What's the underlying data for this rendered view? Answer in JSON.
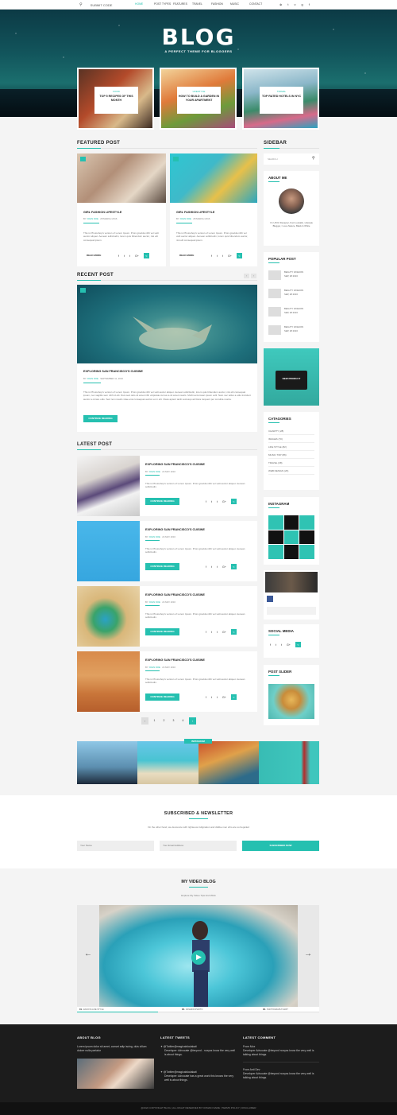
{
  "topbar": {
    "search_placeholder": "SUBMIT CODE",
    "nav": [
      "HOME",
      "POST TYPES",
      "FEATURES",
      "TRAVEL",
      "FASHION",
      "MUSIC",
      "CONTACT"
    ],
    "social_icons": [
      "rss-icon",
      "twitter-icon",
      "vimeo-icon",
      "google-plus-icon",
      "facebook-icon"
    ]
  },
  "hero": {
    "logo": "BLOG",
    "tagline": "A PERFECT THEME FOR BLOGGERS",
    "cards": [
      {
        "category": "FOOD",
        "title": "TOP 5 RECIPES OF THIS MONTH"
      },
      {
        "category": "LIFESTYLE",
        "title": "HOW TO BUILD A GARDEN IN YOUR APARTMENT"
      },
      {
        "category": "TRAVEL",
        "title": "TOP RATED HOTELS IN NYC"
      }
    ]
  },
  "featured": {
    "heading": "FEATURED POST",
    "posts": [
      {
        "title": "GIRL FASHION LIFESTYLE",
        "author": "JOHN DOE",
        "date": "28 MARCH 2016",
        "excerpt": "This is Photoshop's version of Lorem Ipsum. Proin gravida nibh vel velit auctor aliquet. Aenean sollicitudin, lorem quis bibendum auctor, nisi elit consequat ipsum.",
        "read_more": "READ MORE"
      },
      {
        "title": "GIRL FASHION LIFESTYLE",
        "author": "JOHN DOE",
        "date": "28 MARCH 2016",
        "excerpt": "This is Photoshop's version of Lorem Ipsum. Proin gravida nibh vel velit auctor aliquet. Aenean sollicitudin, lorem quis bibendum auctor, nisi elit consequat ipsum.",
        "read_more": "READ MORE"
      }
    ]
  },
  "recent": {
    "heading": "RECENT POST",
    "title": "EXPLORING SAN FRANCISCO'S CUISINE",
    "author": "JOHN DOE",
    "date": "SEPTEMBER 11, 2016",
    "excerpt": "This is Photoshop's version of Lorem Ipsum. Proin gravida nibh vel velit auctor aliquet. Aenean sollicitudin, lorem quis bibendum auctor, nisi elit consequat ipsum, nec sagittis sem nibh id elit. Duis sed odio sit amet nibh vulputate cursus a sit amet mauris. Morbi accumsan ipsum velit. Nam nec tellus a odio tincidunt auctor a ornare odio. Sed non mauris vitae erat consequat auctor eu in elit. Class aptent taciti sociosqu ad litora torquent per conubia nostra.",
    "button": "CONTINUE READING"
  },
  "latest": {
    "heading": "LATEST POST",
    "posts": [
      {
        "title": "EXPLORING SAN FRANCISCO'S CUISINE",
        "author": "JOHN DOE",
        "date": "24 MAY 2016",
        "excerpt": "This is Photoshop's version of Lorem Ipsum. Proin gravida nibh vel velit auctor aliquet. Aenean sollicitudin.",
        "button": "CONTINUE READING"
      },
      {
        "title": "EXPLORING SAN FRANCISCO'S CUISINE",
        "author": "JOHN DOE",
        "date": "24 MAY 2016",
        "excerpt": "This is Photoshop's version of Lorem Ipsum. Proin gravida nibh vel velit auctor aliquet. Aenean sollicitudin.",
        "button": "CONTINUE READING"
      },
      {
        "title": "EXPLORING SAN FRANCISCO'S CUISINE",
        "author": "JOHN DOE",
        "date": "24 MAY 2016",
        "excerpt": "This is Photoshop's version of Lorem Ipsum. Proin gravida nibh vel velit auctor aliquet. Aenean sollicitudin.",
        "button": "CONTINUE READING"
      },
      {
        "title": "EXPLORING SAN FRANCISCO'S CUISINE",
        "author": "JOHN DOE",
        "date": "24 MAY 2016",
        "excerpt": "This is Photoshop's version of Lorem Ipsum. Proin gravida nibh vel velit auctor aliquet. Aenean sollicitudin.",
        "button": "CONTINUE READING"
      }
    ],
    "pagination": [
      "1",
      "2",
      "3",
      "4"
    ]
  },
  "sidebar": {
    "heading": "SIDEBAR",
    "search_placeholder": "SEARCH",
    "about_title": "ABOUT ME",
    "about_text": "I'm UX/UI Designer, Font Lookalin, Lifestyle Blogger, I Love Nature, Black & White",
    "popular_title": "POPULAR POST",
    "popular": [
      {
        "title": "BEAUTY FASHION",
        "date": "SEP, 28 2016"
      },
      {
        "title": "BEAUTY FASHION",
        "date": "SEP, 28 2016"
      },
      {
        "title": "BEAUTY FASHION",
        "date": "SEP, 28 2016"
      },
      {
        "title": "BEAUTY FASHION",
        "date": "SEP, 28 2016"
      }
    ],
    "ad_text": "NEW PRODUCT",
    "categories_title": "CATAGORIES",
    "categories": [
      "CHARITY (28)",
      "IMAGES (70)",
      "LIFE STYLE (82)",
      "MUSIC TOP (86)",
      "TRAVEL (38)",
      "WEB DESIGN (26)"
    ],
    "instagram_title": "INSTAGRAM",
    "social_title": "SOCIAL MEDIA",
    "slider_title": "POST SLIDER"
  },
  "instagram_strip": {
    "label": "INSTAGRAM"
  },
  "newsletter": {
    "title": "SUBSCRIBED & NEWSLETTER",
    "text": "On the other hand, we denounce with righteous indignation and dislike men who are so beguiled",
    "name_placeholder": "Your Name",
    "email_placeholder": "Your Email Address",
    "button": "SUBSCRIBED NOW"
  },
  "video": {
    "title": "MY VIDEO BLOG",
    "subtitle": "Explore My Video Tips And Work",
    "captions": [
      "ENJOYE LIFE STYLE",
      "FASHION PHOTO",
      "PHOTOGRAPHY EDIT"
    ]
  },
  "footer": {
    "about_title": "ABOUT BLOG",
    "about_text": "Lorem ipsum dolor sit amet, conset adip iscing, duis cillum dolore nulla pariatur",
    "tweets_title": "LATEST TWEETS",
    "tweets": [
      {
        "handle": "@Twitter@magicalslodakati",
        "text": "Developer: Advocate @beyond - noxyss know the very well is about things."
      },
      {
        "handle": "@Twitter@magicalslodakati",
        "text": "Developer: Advocate has a great work this knows the very well is about things."
      }
    ],
    "comment_title": "LATEST COMMENT",
    "comments": [
      {
        "author": "From Mox",
        "text": "Developer Advocate @beyond noxyss know the very well is talking about things."
      },
      {
        "author": "From Anti Dev",
        "text": "Developer Advocate @beyond noxyss know the very well is talking about things."
      }
    ],
    "copyright": "@2022 COPYRIGHT BLOG | ALL RIGHT RESERVED BY DOMAIN NAME | TERMS POLICY | DISCLAIMER"
  },
  "colors": {
    "accent": "#25c0b0",
    "dark": "#1c1c1c"
  }
}
